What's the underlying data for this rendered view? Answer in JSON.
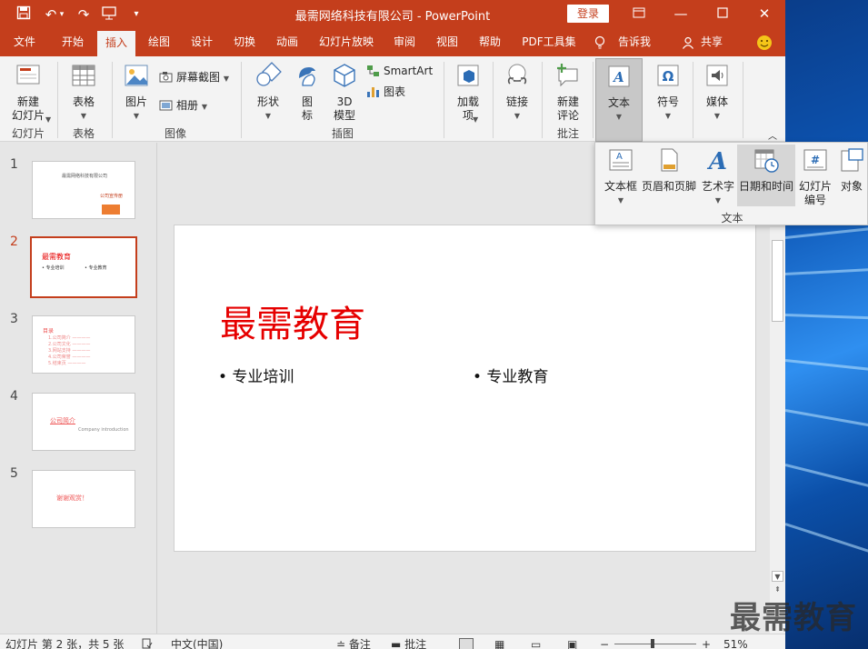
{
  "window": {
    "title": "最需网络科技有限公司  -  PowerPoint",
    "login_label": "登录"
  },
  "menu_tabs": [
    {
      "label": "文件",
      "active": false
    },
    {
      "label": "开始",
      "active": false
    },
    {
      "label": "插入",
      "active": true
    },
    {
      "label": "绘图",
      "active": false
    },
    {
      "label": "设计",
      "active": false
    },
    {
      "label": "切换",
      "active": false
    },
    {
      "label": "动画",
      "active": false
    },
    {
      "label": "幻灯片放映",
      "active": false
    },
    {
      "label": "审阅",
      "active": false
    },
    {
      "label": "视图",
      "active": false
    },
    {
      "label": "帮助",
      "active": false
    },
    {
      "label": "PDF工具集",
      "active": false
    },
    {
      "label": "告诉我",
      "active": false
    },
    {
      "label": "共享",
      "active": false
    }
  ],
  "ribbon": {
    "new_slide": "新建\n幻灯片",
    "group_slides": "幻灯片",
    "table": "表格",
    "group_table": "表格",
    "pictures": "图片",
    "screenshot": "屏幕截图",
    "album": "相册",
    "group_images": "图像",
    "shapes": "形状",
    "icons": "图\n标",
    "model3d": "3D\n模型",
    "smartart": "SmartArt",
    "chart": "图表",
    "group_illustrations": "插图",
    "addins": "加载\n项",
    "link": "链接",
    "new_comment": "新建\n评论",
    "group_comments": "批注",
    "text": "文本",
    "symbols": "符号",
    "media": "媒体"
  },
  "text_dropdown": {
    "textbox": "文本框",
    "header_footer": "页眉和页脚",
    "wordart": "艺术字",
    "datetime": "日期和时间",
    "slide_number": "幻灯片\n编号",
    "object": "对象",
    "group_label": "文本"
  },
  "thumbnails": [
    {
      "num": "1",
      "lines": [
        "最需网络科技有限公司",
        "公司宣传册"
      ]
    },
    {
      "num": "2",
      "lines": [
        "最需教育",
        "• 专业培训",
        "• 专业教育"
      ]
    },
    {
      "num": "3",
      "lines": [
        "目录",
        "1.公司简介 ————",
        "2.公司文化 ————",
        "3.网站支持 ————",
        "4.公司荣誉 ————",
        "5.结束页 ————"
      ]
    },
    {
      "num": "4",
      "lines": [
        "公司简介",
        "Company introduction"
      ]
    },
    {
      "num": "5",
      "lines": [
        "谢谢观赏！"
      ]
    }
  ],
  "slide": {
    "title": "最需教育",
    "bullet_left": "• 专业培训",
    "bullet_right": "• 专业教育"
  },
  "statusbar": {
    "slide_info": "幻灯片 第 2 张，共 5 张",
    "language": "中文(中国)",
    "notes": "备注",
    "comments": "批注",
    "zoom": "51%"
  },
  "watermark": "最需教育",
  "colors": {
    "accent": "#c43e1c",
    "slide_title": "#e60000"
  }
}
